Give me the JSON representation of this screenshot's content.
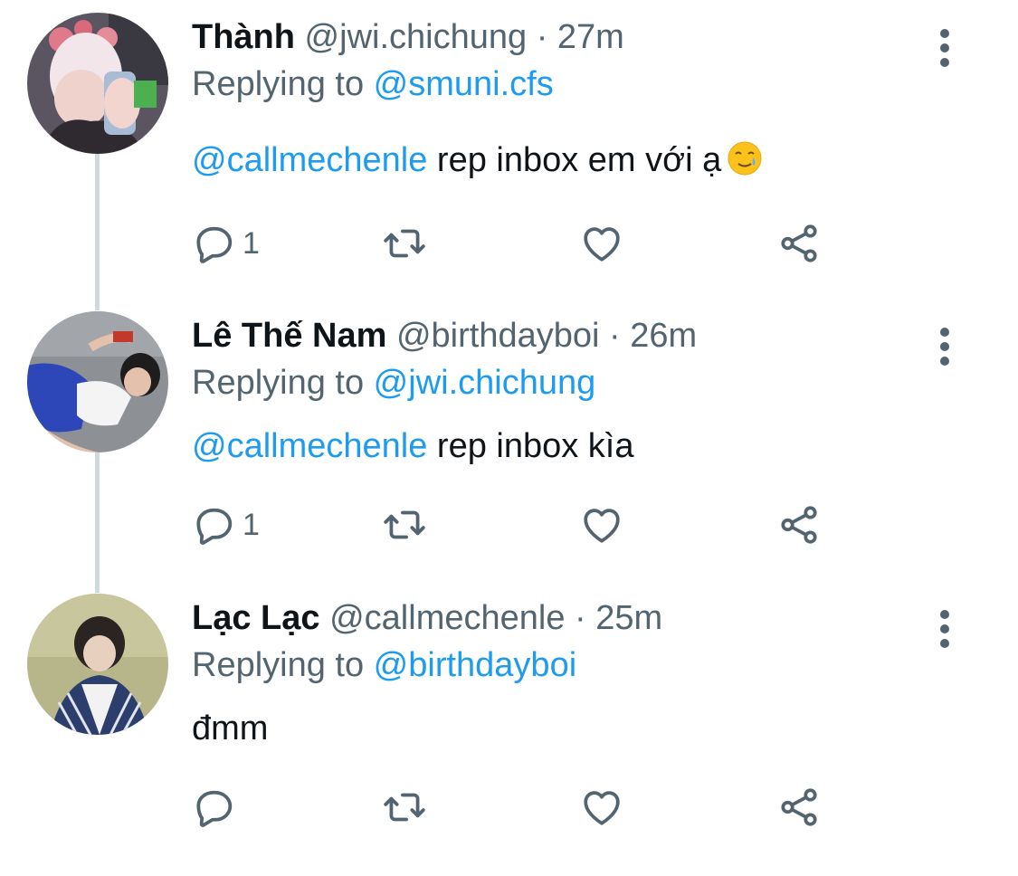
{
  "tweets": [
    {
      "name": "Thành",
      "handle": "@jwi.chichung",
      "sep": "·",
      "time": "27m",
      "replying_prefix": "Replying to ",
      "replying_to": "@smuni.cfs",
      "mention": "@callmechenle",
      "text": " rep inbox em với ạ",
      "emoji": "smiling-face-with-tear",
      "reply_count": "1"
    },
    {
      "name": "Lê Thế Nam",
      "handle": "@birthdayboi",
      "sep": "·",
      "time": "26m",
      "replying_prefix": "Replying to ",
      "replying_to": "@jwi.chichung",
      "mention": "@callmechenle",
      "text": " rep inbox kìa",
      "reply_count": "1"
    },
    {
      "name": "Lạc Lạc",
      "handle": "@callmechenle",
      "sep": "·",
      "time": "25m",
      "replying_prefix": "Replying to ",
      "replying_to": "@birthdayboi",
      "mention": "",
      "text": "đmm",
      "reply_count": ""
    }
  ],
  "colors": {
    "link": "#1d9bf0",
    "muted": "#536471",
    "text": "#0f1419",
    "thread_line": "#cfd9de"
  },
  "icons": {
    "reply": "reply-icon",
    "retweet": "retweet-icon",
    "like": "like-icon",
    "share": "share-icon",
    "more": "more-icon"
  }
}
